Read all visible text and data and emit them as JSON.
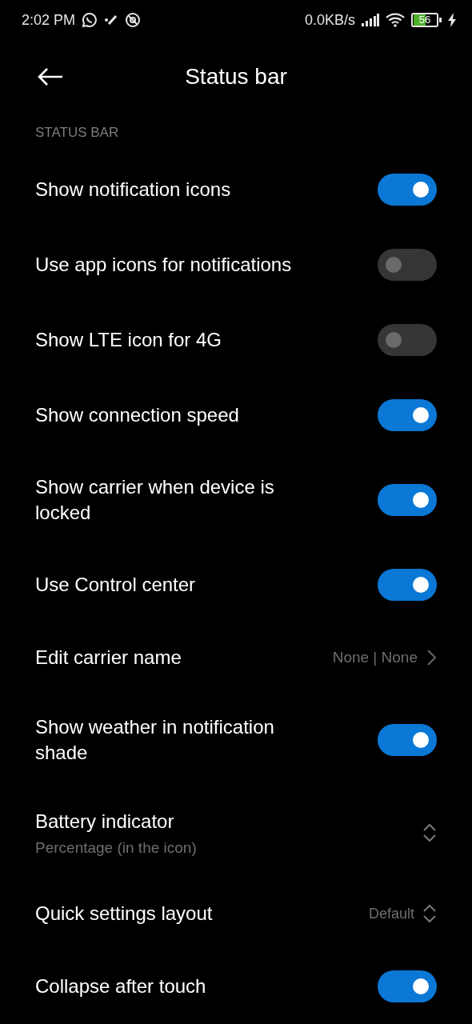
{
  "status_bar": {
    "time": "2:02 PM",
    "network_speed": "0.0KB/s",
    "battery": "56"
  },
  "header": {
    "title": "Status bar"
  },
  "section": {
    "title": "STATUS BAR"
  },
  "settings": [
    {
      "kind": "toggle",
      "label": "Show notification icons",
      "on": true
    },
    {
      "kind": "toggle",
      "label": "Use app icons for notifications",
      "on": false
    },
    {
      "kind": "toggle",
      "label": "Show LTE icon for 4G",
      "on": false
    },
    {
      "kind": "toggle",
      "label": "Show connection speed",
      "on": true
    },
    {
      "kind": "toggle",
      "label": "Show carrier when device is locked",
      "on": true
    },
    {
      "kind": "toggle",
      "label": "Use Control center",
      "on": true
    },
    {
      "kind": "link",
      "label": "Edit carrier name",
      "value": "None | None"
    },
    {
      "kind": "toggle",
      "label": "Show weather in notification shade",
      "on": true
    },
    {
      "kind": "select",
      "label": "Battery indicator",
      "subtitle": "Percentage (in the icon)"
    },
    {
      "kind": "select",
      "label": "Quick settings layout",
      "value": "Default"
    },
    {
      "kind": "toggle",
      "label": "Collapse after touch",
      "on": true
    }
  ]
}
